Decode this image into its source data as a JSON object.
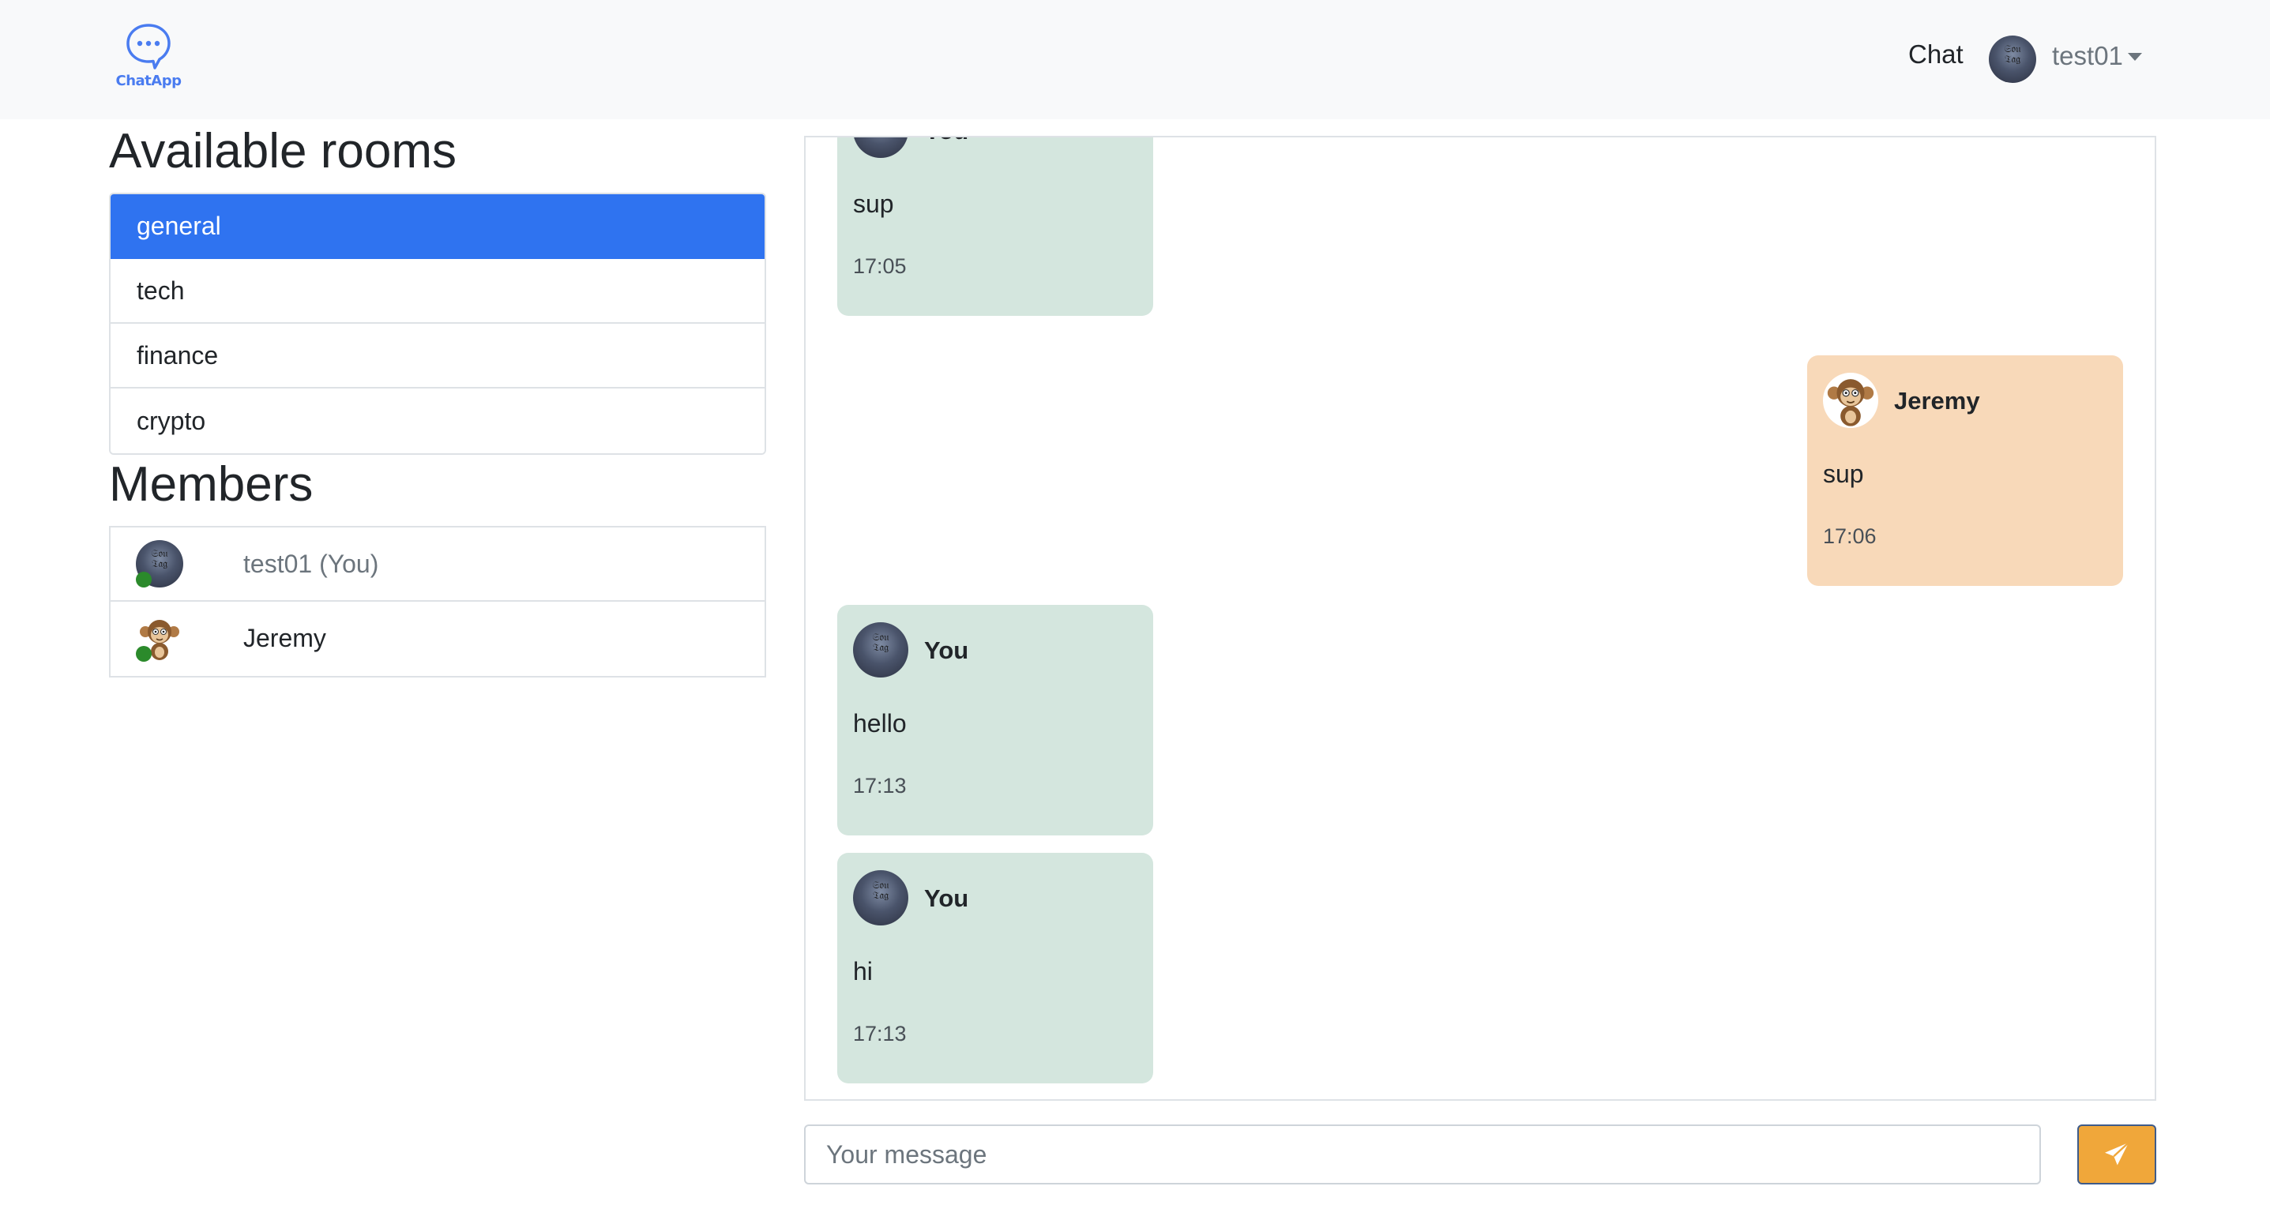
{
  "navbar": {
    "logo_text": "ChatApp",
    "chat_link": "Chat",
    "username": "test01",
    "logo_icon": "chat-bubble-icon"
  },
  "sidebar": {
    "rooms_heading": "Available rooms",
    "rooms": [
      {
        "label": "general",
        "active": true
      },
      {
        "label": "tech",
        "active": false
      },
      {
        "label": "finance",
        "active": false
      },
      {
        "label": "crypto",
        "active": false
      }
    ],
    "members_heading": "Members",
    "members": [
      {
        "name": "test01 (You)",
        "status": "online"
      },
      {
        "name": "Jeremy",
        "status": "online"
      }
    ]
  },
  "messages": [
    {
      "author": "You",
      "text": "sup",
      "time": "17:05"
    },
    {
      "author": "Jeremy",
      "text": "sup",
      "time": "17:06"
    },
    {
      "author": "You",
      "text": "hello",
      "time": "17:13"
    },
    {
      "author": "You",
      "text": "hi",
      "time": "17:13"
    }
  ],
  "composer": {
    "placeholder": "Your message",
    "value": "",
    "send_icon": "paper-plane-icon"
  },
  "colors": {
    "active_room": "#2f73f0",
    "own_message": "#d4e6de",
    "other_message": "#f8d9b9",
    "send_button": "#f0a73a",
    "online_dot": "#2b8a2b",
    "brand": "#4a7cf0"
  }
}
